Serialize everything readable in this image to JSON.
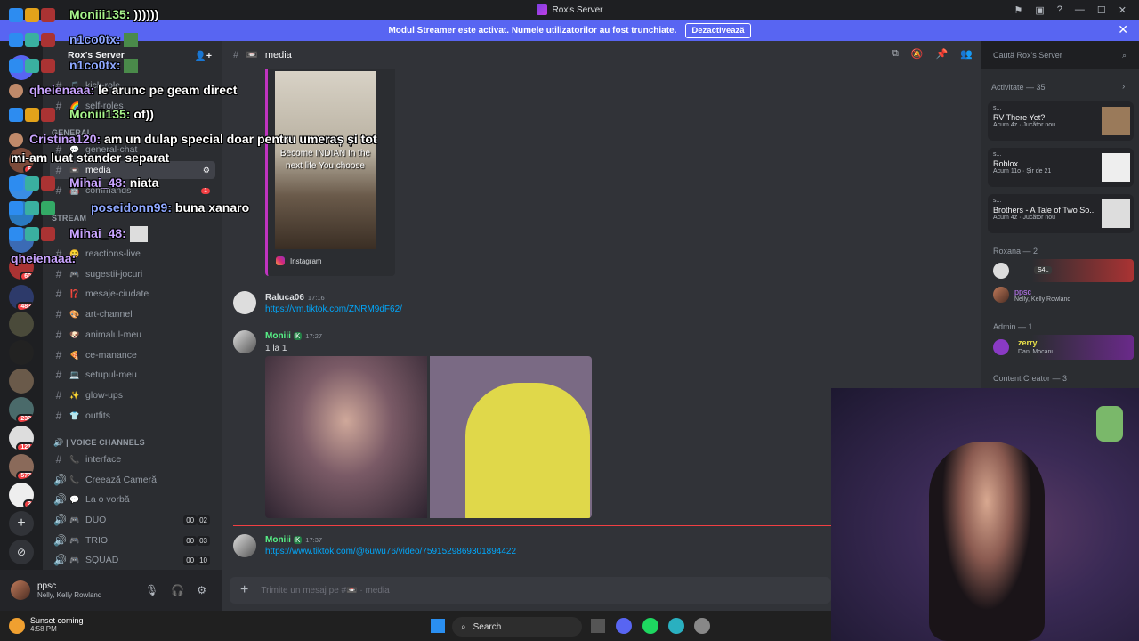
{
  "window": {
    "title": "Rox's Server"
  },
  "banner": {
    "text": "Modul Streamer este activat. Numele utilizatorilor au fost trunchiate.",
    "button": "Dezactivează"
  },
  "server": {
    "name": "Rox's Server"
  },
  "rail": {
    "badges": [
      "6",
      "60",
      "483",
      "232",
      "121",
      "577",
      "2"
    ]
  },
  "sidebar": {
    "categories": {
      "general": "GENERAL",
      "stream": "STREAM",
      "voice": "| VOICE CHANNELS"
    },
    "channels_top": [
      {
        "name": "kick-role",
        "emoji": "🎵"
      },
      {
        "name": "self-roles",
        "emoji": "🌈"
      },
      {
        "name": "general-chat",
        "emoji": "💬"
      },
      {
        "name": "media",
        "emoji": "📼"
      },
      {
        "name": "commands",
        "emoji": "🤖",
        "badge": "1"
      }
    ],
    "channels_text": [
      {
        "name": "reactions-live",
        "emoji": "😀"
      },
      {
        "name": "sugestii-jocuri",
        "emoji": "🎮"
      },
      {
        "name": "mesaje-ciudate",
        "emoji": "⁉️"
      },
      {
        "name": "art-channel",
        "emoji": "🎨"
      },
      {
        "name": "animalul-meu",
        "emoji": "🐶"
      },
      {
        "name": "ce-manance",
        "emoji": "🍕"
      },
      {
        "name": "setupul-meu",
        "emoji": "💻"
      },
      {
        "name": "glow-ups",
        "emoji": "✨"
      },
      {
        "name": "outfits",
        "emoji": "👕"
      }
    ],
    "channels_voice": [
      {
        "name": "interface",
        "emoji": "📞",
        "hash": true
      },
      {
        "name": "Creează Cameră",
        "emoji": "📞"
      },
      {
        "name": "La o vorbă",
        "emoji": "💬"
      },
      {
        "name": "DUO",
        "emoji": "🎮",
        "a": "00",
        "b": "02"
      },
      {
        "name": "TRIO",
        "emoji": "🎮",
        "a": "00",
        "b": "03"
      },
      {
        "name": "SQUAD",
        "emoji": "🎮",
        "a": "00",
        "b": "10"
      }
    ]
  },
  "user": {
    "name": "ppsc",
    "status": "Nelly, Kelly Rowland"
  },
  "channel": {
    "name": "media",
    "emoji": "📼",
    "search_placeholder": "Caută Rox's Server"
  },
  "messages": {
    "embed_caption": "Become INDIAN In the next life You choose",
    "embed_source": "Instagram",
    "m1": {
      "author": "Raluca06",
      "time": "17:16",
      "link": "https://vm.tiktok.com/ZNRM9dF62/"
    },
    "m2": {
      "author": "Moniii",
      "time": "17:27",
      "text": "1 la 1"
    },
    "m3": {
      "author": "Moniii",
      "time": "17:37",
      "link": "https://www.tiktok.com/@6uwu76/video/7591529869301894422"
    }
  },
  "composer": {
    "placeholder": "Trimite un mesaj pe #📼 · media"
  },
  "members": {
    "activity_header": "Activitate — 35",
    "activities": [
      {
        "user": "s...",
        "title": "RV There Yet?",
        "meta": "Acum 4z · Jucător nou"
      },
      {
        "user": "s...",
        "title": "Roblox",
        "meta": "Acum 11o · Șir de 21"
      },
      {
        "user": "s...",
        "title": "Brothers - A Tale of Two So...",
        "meta": "Acum 4z · Jucător nou"
      }
    ],
    "roxana_header": "Roxana — 2",
    "roxana_tag": "S4L",
    "ppsc_name": "ppsc",
    "ppsc_status": "Nelly, Kelly Rowland",
    "admin_header": "Admin — 1",
    "admin_name": "zerry",
    "admin_status": "Dani Mocanu",
    "creator_header": "Content Creator — 3"
  },
  "overlay_chat": [
    {
      "user": "Moniii135:",
      "msg": "))))))",
      "color": "#a6f28b"
    },
    {
      "user": "n1co0tx:",
      "msg": "",
      "color": "#8ea7ff"
    },
    {
      "user": "n1co0tx:",
      "msg": "",
      "color": "#8ea7ff"
    },
    {
      "user": "qheienaaa:",
      "msg": "le arunc pe geam direct",
      "color": "#c9a4ff"
    },
    {
      "user": "Moniii135:",
      "msg": "of))",
      "color": "#a6f28b"
    },
    {
      "user": "Cristina120:",
      "msg": "am un dulap special doar pentru umeraș și tot",
      "color": "#c9a4ff"
    },
    {
      "user": "",
      "msg": "mi-am luat stander separat",
      "color": "#ffffff"
    },
    {
      "user": "Mihai_48:",
      "msg": "niata",
      "color": "#c9a4ff"
    },
    {
      "user": "poseidonn99:",
      "msg": "buna xanaro",
      "color": "#8ea7ff"
    },
    {
      "user": "Mihai_48:",
      "msg": "",
      "color": "#c9a4ff"
    },
    {
      "user": "qheienaaa:",
      "msg": "",
      "color": "#c9a4ff"
    }
  ],
  "taskbar": {
    "weather_title": "Sunset coming",
    "time": "4:58 PM",
    "search": "Search"
  }
}
